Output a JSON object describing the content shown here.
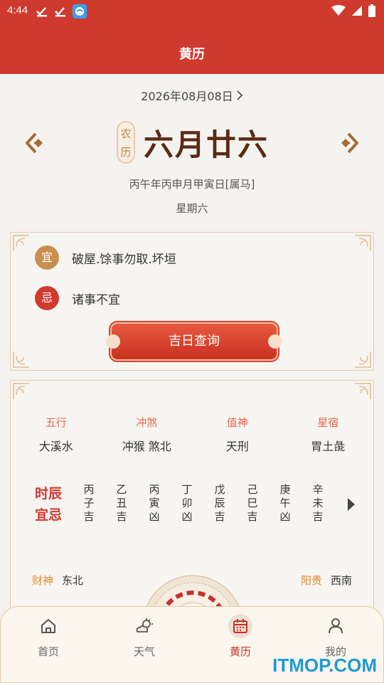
{
  "status_bar": {
    "time": "4:44"
  },
  "header": {
    "title": "黄历"
  },
  "date": {
    "solar": "2026年08月08日"
  },
  "lunar": {
    "badge_top": "农",
    "badge_bottom": "历",
    "date": "六月廿六"
  },
  "ganzhi": "丙午年丙申月甲寅日[属马]",
  "weekday": "星期六",
  "yiji": {
    "yi_icon": "宜",
    "yi_text": "破屋.馀事勿取.坏垣",
    "ji_icon": "忌",
    "ji_text": "诸事不宜",
    "query_button": "吉日查询"
  },
  "info": [
    {
      "label": "五行",
      "value": "大溪水",
      "color": "#e06a4c"
    },
    {
      "label": "冲煞",
      "value": "冲猴 煞北",
      "color": "#e06a4c"
    },
    {
      "label": "值神",
      "value": "天刑",
      "color": "#e06a4c"
    },
    {
      "label": "星宿",
      "value": "胃土彘",
      "color": "#e06a4c"
    }
  ],
  "shichen": {
    "title_line1": "时辰",
    "title_line2": "宜忌",
    "items": [
      {
        "a": "丙",
        "b": "子",
        "c": "吉"
      },
      {
        "a": "乙",
        "b": "丑",
        "c": "吉"
      },
      {
        "a": "丙",
        "b": "寅",
        "c": "凶"
      },
      {
        "a": "丁",
        "b": "卯",
        "c": "凶"
      },
      {
        "a": "戊",
        "b": "辰",
        "c": "吉"
      },
      {
        "a": "己",
        "b": "巳",
        "c": "吉"
      },
      {
        "a": "庚",
        "b": "午",
        "c": "凶"
      },
      {
        "a": "辛",
        "b": "未",
        "c": "吉"
      }
    ]
  },
  "gods": {
    "caishen_label": "财神",
    "caishen_value": "东北",
    "yanggui_label": "阳贵",
    "yanggui_value": "西南"
  },
  "tabs": [
    {
      "label": "首页",
      "icon": "home-icon"
    },
    {
      "label": "天气",
      "icon": "weather-icon"
    },
    {
      "label": "黄历",
      "icon": "calendar-icon"
    },
    {
      "label": "我的",
      "icon": "user-icon"
    }
  ],
  "watermark": "ITMOP.COM",
  "colors": {
    "primary_red": "#cf3a2e",
    "gold": "#c98f4f",
    "orange_label": "#e48a2c",
    "bg": "#f5f3ef"
  }
}
